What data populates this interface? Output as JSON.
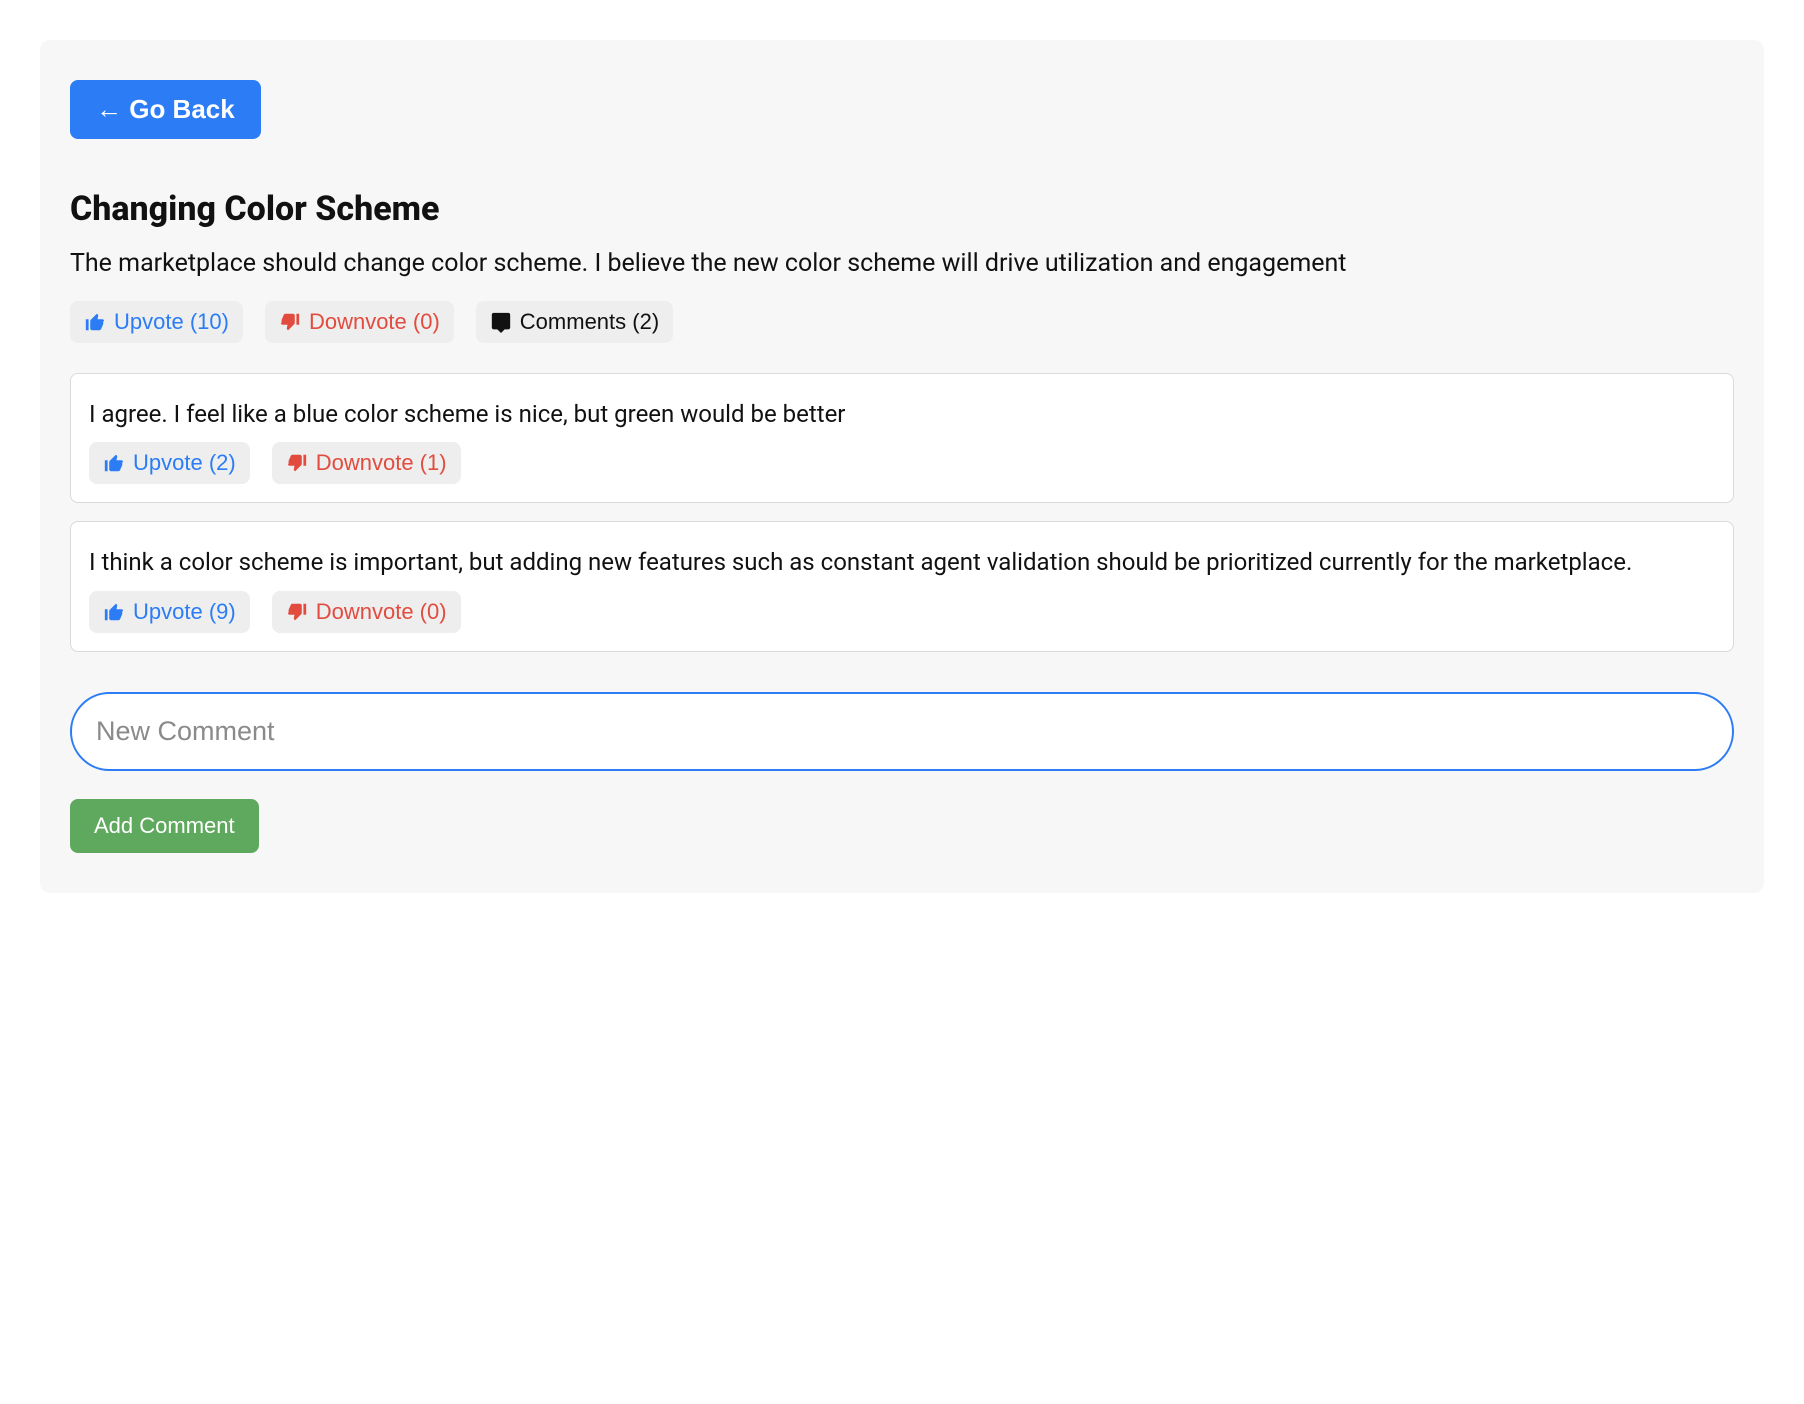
{
  "nav": {
    "go_back_label": "← Go Back"
  },
  "post": {
    "title": "Changing Color Scheme",
    "description": "The marketplace should change color scheme. I believe the new color scheme will drive utilization and engagement",
    "upvote_label": "Upvote (10)",
    "downvote_label": "Downvote (0)",
    "comments_label": "Comments (2)"
  },
  "comments": [
    {
      "text": "I agree. I feel like a blue color scheme is nice, but green would be better",
      "upvote_label": "Upvote (2)",
      "downvote_label": "Downvote (1)"
    },
    {
      "text": "I think a color scheme is important, but adding new features such as constant agent validation should be prioritized currently for the marketplace.",
      "upvote_label": "Upvote (9)",
      "downvote_label": "Downvote (0)"
    }
  ],
  "new_comment": {
    "placeholder": "New Comment",
    "value": ""
  },
  "buttons": {
    "add_comment_label": "Add Comment"
  },
  "colors": {
    "primary": "#2b7cf5",
    "danger": "#e24c3f",
    "success": "#5ea95e"
  }
}
